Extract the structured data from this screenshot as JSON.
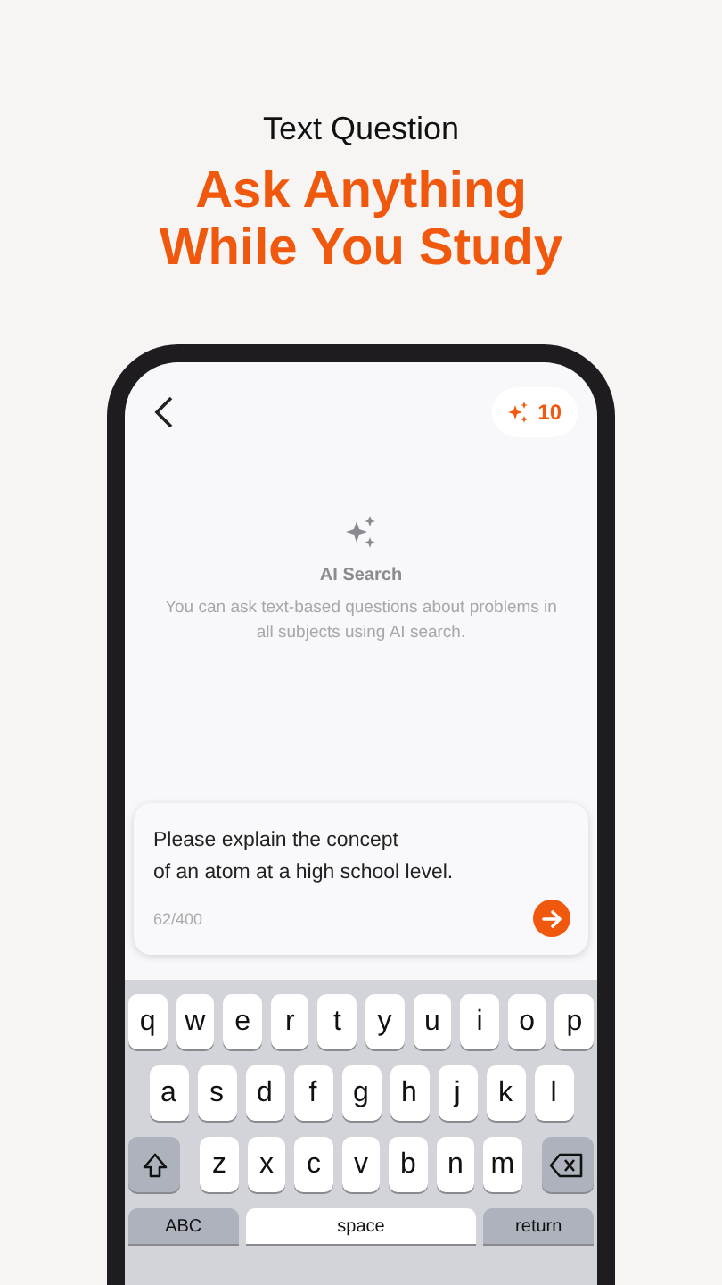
{
  "header": {
    "subtitle": "Text Question",
    "title_lines": [
      "Ask Anything",
      "While You Study"
    ]
  },
  "top_bar": {
    "credits": "10"
  },
  "empty_state": {
    "title": "AI Search",
    "description": "You can ask text-based questions about problems in all subjects using AI search."
  },
  "question_field": {
    "value_lines": [
      "Please explain the concept",
      "of an atom at a high school level."
    ],
    "counter": "62/400"
  },
  "keyboard": {
    "rows": [
      {
        "keys": [
          {
            "kind": "letter",
            "label": "q"
          },
          {
            "kind": "letter",
            "label": "w"
          },
          {
            "kind": "letter",
            "label": "e"
          },
          {
            "kind": "letter",
            "label": "r"
          },
          {
            "kind": "letter",
            "label": "t"
          },
          {
            "kind": "letter",
            "label": "y"
          },
          {
            "kind": "letter",
            "label": "u"
          },
          {
            "kind": "letter",
            "label": "i"
          },
          {
            "kind": "letter",
            "label": "o"
          },
          {
            "kind": "letter",
            "label": "p"
          }
        ]
      },
      {
        "keys": [
          {
            "kind": "letter",
            "label": "a"
          },
          {
            "kind": "letter",
            "label": "s"
          },
          {
            "kind": "letter",
            "label": "d"
          },
          {
            "kind": "letter",
            "label": "f"
          },
          {
            "kind": "letter",
            "label": "g"
          },
          {
            "kind": "letter",
            "label": "h"
          },
          {
            "kind": "letter",
            "label": "j"
          },
          {
            "kind": "letter",
            "label": "k"
          },
          {
            "kind": "letter",
            "label": "l"
          }
        ]
      },
      {
        "keys": [
          {
            "kind": "shift"
          },
          {
            "kind": "letter",
            "label": "z"
          },
          {
            "kind": "letter",
            "label": "x"
          },
          {
            "kind": "letter",
            "label": "c"
          },
          {
            "kind": "letter",
            "label": "v"
          },
          {
            "kind": "letter",
            "label": "b"
          },
          {
            "kind": "letter",
            "label": "n"
          },
          {
            "kind": "letter",
            "label": "m"
          },
          {
            "kind": "delete"
          }
        ]
      },
      {
        "keys": [
          {
            "kind": "mode",
            "label": "ABC"
          },
          {
            "kind": "space",
            "label": "space"
          },
          {
            "kind": "mode",
            "label": "return"
          }
        ]
      }
    ]
  }
}
